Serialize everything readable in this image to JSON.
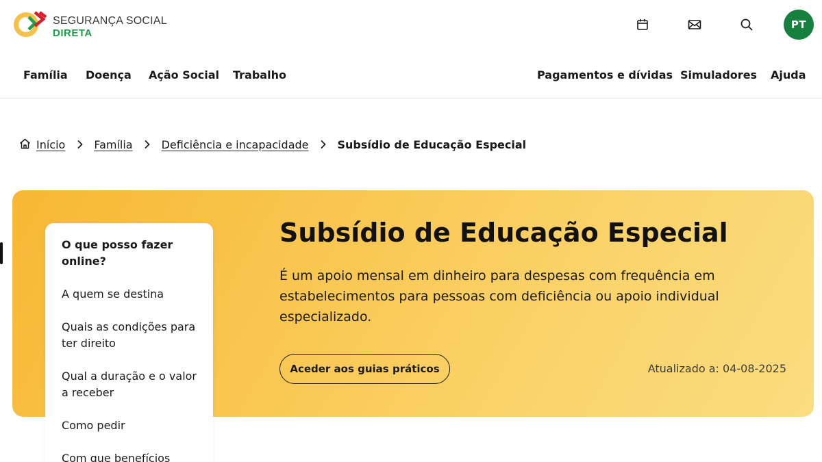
{
  "brand": {
    "line1": "SEGURANÇA SOCIAL",
    "line2": "DIRETA",
    "colors": {
      "green": "#1f9e4a",
      "red": "#d81e2a",
      "yellow": "#f6c14a"
    }
  },
  "header_icons": [
    "calendar-icon",
    "mail-icon",
    "search-icon"
  ],
  "language": "PT",
  "nav": {
    "left": [
      "Família",
      "Doença",
      "Ação Social",
      "Trabalho"
    ],
    "right": [
      "Pagamentos e dívidas",
      "Simuladores",
      "Ajuda"
    ]
  },
  "breadcrumb": {
    "items": [
      "Início",
      "Família",
      "Deficiência e incapacidade"
    ],
    "current": "Subsídio de Educação Especial"
  },
  "hero": {
    "title": "Subsídio de Educação Especial",
    "description": "É um apoio mensal em dinheiro para despesas com frequência em estabelecimentos para pessoas com deficiência ou apoio individual especializado.",
    "button": "Aceder aos guias práticos",
    "updated": "Atualizado a: 04-08-2025",
    "gradient": [
      "#f7b733",
      "#fbdc80"
    ]
  },
  "side_menu": {
    "items": [
      "O que posso fazer online?",
      "A quem se destina",
      "Quais as condições para ter direito",
      "Qual a duração e o valor a receber",
      "Como pedir",
      "Com que benefícios"
    ],
    "active_index": 0
  }
}
